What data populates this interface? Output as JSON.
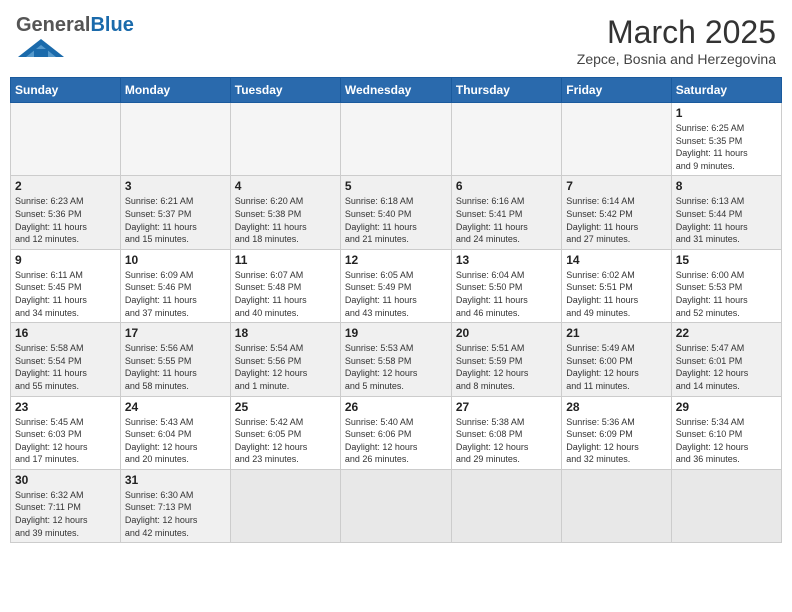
{
  "header": {
    "logo_general": "General",
    "logo_blue": "Blue",
    "month_year": "March 2025",
    "location": "Zepce, Bosnia and Herzegovina"
  },
  "weekdays": [
    "Sunday",
    "Monday",
    "Tuesday",
    "Wednesday",
    "Thursday",
    "Friday",
    "Saturday"
  ],
  "weeks": [
    [
      {
        "day": "",
        "info": ""
      },
      {
        "day": "",
        "info": ""
      },
      {
        "day": "",
        "info": ""
      },
      {
        "day": "",
        "info": ""
      },
      {
        "day": "",
        "info": ""
      },
      {
        "day": "",
        "info": ""
      },
      {
        "day": "1",
        "info": "Sunrise: 6:25 AM\nSunset: 5:35 PM\nDaylight: 11 hours\nand 9 minutes."
      }
    ],
    [
      {
        "day": "2",
        "info": "Sunrise: 6:23 AM\nSunset: 5:36 PM\nDaylight: 11 hours\nand 12 minutes."
      },
      {
        "day": "3",
        "info": "Sunrise: 6:21 AM\nSunset: 5:37 PM\nDaylight: 11 hours\nand 15 minutes."
      },
      {
        "day": "4",
        "info": "Sunrise: 6:20 AM\nSunset: 5:38 PM\nDaylight: 11 hours\nand 18 minutes."
      },
      {
        "day": "5",
        "info": "Sunrise: 6:18 AM\nSunset: 5:40 PM\nDaylight: 11 hours\nand 21 minutes."
      },
      {
        "day": "6",
        "info": "Sunrise: 6:16 AM\nSunset: 5:41 PM\nDaylight: 11 hours\nand 24 minutes."
      },
      {
        "day": "7",
        "info": "Sunrise: 6:14 AM\nSunset: 5:42 PM\nDaylight: 11 hours\nand 27 minutes."
      },
      {
        "day": "8",
        "info": "Sunrise: 6:13 AM\nSunset: 5:44 PM\nDaylight: 11 hours\nand 31 minutes."
      }
    ],
    [
      {
        "day": "9",
        "info": "Sunrise: 6:11 AM\nSunset: 5:45 PM\nDaylight: 11 hours\nand 34 minutes."
      },
      {
        "day": "10",
        "info": "Sunrise: 6:09 AM\nSunset: 5:46 PM\nDaylight: 11 hours\nand 37 minutes."
      },
      {
        "day": "11",
        "info": "Sunrise: 6:07 AM\nSunset: 5:48 PM\nDaylight: 11 hours\nand 40 minutes."
      },
      {
        "day": "12",
        "info": "Sunrise: 6:05 AM\nSunset: 5:49 PM\nDaylight: 11 hours\nand 43 minutes."
      },
      {
        "day": "13",
        "info": "Sunrise: 6:04 AM\nSunset: 5:50 PM\nDaylight: 11 hours\nand 46 minutes."
      },
      {
        "day": "14",
        "info": "Sunrise: 6:02 AM\nSunset: 5:51 PM\nDaylight: 11 hours\nand 49 minutes."
      },
      {
        "day": "15",
        "info": "Sunrise: 6:00 AM\nSunset: 5:53 PM\nDaylight: 11 hours\nand 52 minutes."
      }
    ],
    [
      {
        "day": "16",
        "info": "Sunrise: 5:58 AM\nSunset: 5:54 PM\nDaylight: 11 hours\nand 55 minutes."
      },
      {
        "day": "17",
        "info": "Sunrise: 5:56 AM\nSunset: 5:55 PM\nDaylight: 11 hours\nand 58 minutes."
      },
      {
        "day": "18",
        "info": "Sunrise: 5:54 AM\nSunset: 5:56 PM\nDaylight: 12 hours\nand 1 minute."
      },
      {
        "day": "19",
        "info": "Sunrise: 5:53 AM\nSunset: 5:58 PM\nDaylight: 12 hours\nand 5 minutes."
      },
      {
        "day": "20",
        "info": "Sunrise: 5:51 AM\nSunset: 5:59 PM\nDaylight: 12 hours\nand 8 minutes."
      },
      {
        "day": "21",
        "info": "Sunrise: 5:49 AM\nSunset: 6:00 PM\nDaylight: 12 hours\nand 11 minutes."
      },
      {
        "day": "22",
        "info": "Sunrise: 5:47 AM\nSunset: 6:01 PM\nDaylight: 12 hours\nand 14 minutes."
      }
    ],
    [
      {
        "day": "23",
        "info": "Sunrise: 5:45 AM\nSunset: 6:03 PM\nDaylight: 12 hours\nand 17 minutes."
      },
      {
        "day": "24",
        "info": "Sunrise: 5:43 AM\nSunset: 6:04 PM\nDaylight: 12 hours\nand 20 minutes."
      },
      {
        "day": "25",
        "info": "Sunrise: 5:42 AM\nSunset: 6:05 PM\nDaylight: 12 hours\nand 23 minutes."
      },
      {
        "day": "26",
        "info": "Sunrise: 5:40 AM\nSunset: 6:06 PM\nDaylight: 12 hours\nand 26 minutes."
      },
      {
        "day": "27",
        "info": "Sunrise: 5:38 AM\nSunset: 6:08 PM\nDaylight: 12 hours\nand 29 minutes."
      },
      {
        "day": "28",
        "info": "Sunrise: 5:36 AM\nSunset: 6:09 PM\nDaylight: 12 hours\nand 32 minutes."
      },
      {
        "day": "29",
        "info": "Sunrise: 5:34 AM\nSunset: 6:10 PM\nDaylight: 12 hours\nand 36 minutes."
      }
    ],
    [
      {
        "day": "30",
        "info": "Sunrise: 6:32 AM\nSunset: 7:11 PM\nDaylight: 12 hours\nand 39 minutes."
      },
      {
        "day": "31",
        "info": "Sunrise: 6:30 AM\nSunset: 7:13 PM\nDaylight: 12 hours\nand 42 minutes."
      },
      {
        "day": "",
        "info": ""
      },
      {
        "day": "",
        "info": ""
      },
      {
        "day": "",
        "info": ""
      },
      {
        "day": "",
        "info": ""
      },
      {
        "day": "",
        "info": ""
      }
    ]
  ]
}
